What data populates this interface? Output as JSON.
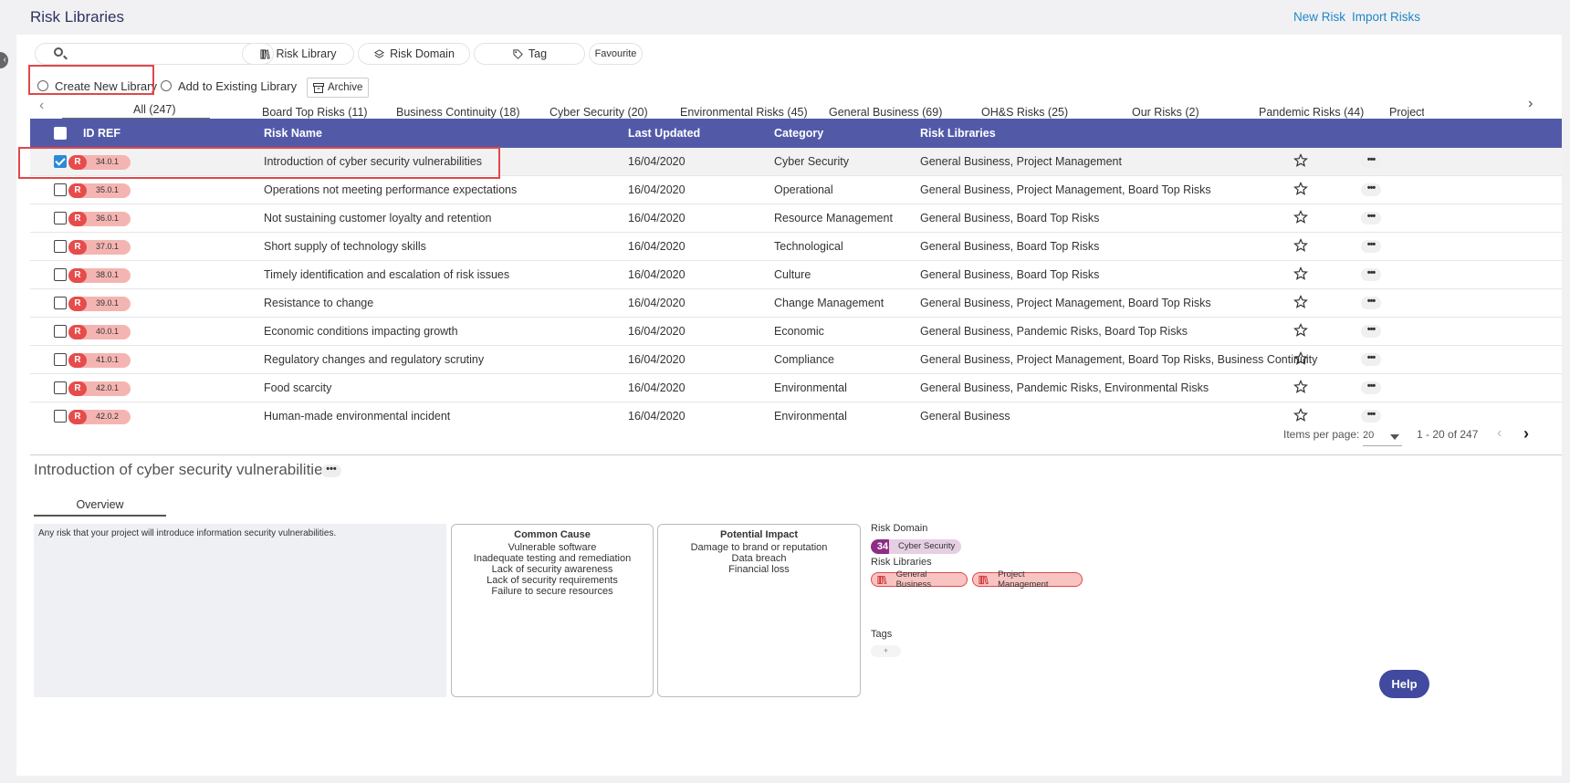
{
  "app": {
    "title": "Risk Libraries"
  },
  "header": {
    "new_risk": "New Risk",
    "import_risks": "Import Risks"
  },
  "search": {
    "value": "",
    "placeholder": ""
  },
  "filters": {
    "risk_library": "Risk Library",
    "risk_domain": "Risk Domain",
    "tag": "Tag",
    "favourite": "Favourite"
  },
  "actions": {
    "create_new_library": "Create New Library",
    "add_to_existing_library": "Add to Existing Library",
    "archive": "Archive"
  },
  "tabs": [
    {
      "label": "All (247)",
      "active": true
    },
    {
      "label": "Board Top Risks (11)"
    },
    {
      "label": "Business Continuity (18)"
    },
    {
      "label": "Cyber Security (20)"
    },
    {
      "label": "Environmental Risks (45)"
    },
    {
      "label": "General Business (69)"
    },
    {
      "label": "OH&S Risks (25)"
    },
    {
      "label": "Our Risks (2)"
    },
    {
      "label": "Pandemic Risks (44)"
    },
    {
      "label": "Project"
    }
  ],
  "table": {
    "headers": {
      "id_ref": "ID REF",
      "risk_name": "Risk Name",
      "last_updated": "Last Updated",
      "category": "Category",
      "risk_libraries": "Risk Libraries"
    },
    "rows": [
      {
        "badge": "R",
        "id": "34.0.1",
        "name": "Introduction of cyber security vulnerabilities",
        "updated": "16/04/2020",
        "category": "Cyber Security",
        "libraries": "General Business, Project Management",
        "checked": true
      },
      {
        "badge": "R",
        "id": "35.0.1",
        "name": "Operations not meeting performance expectations",
        "updated": "16/04/2020",
        "category": "Operational",
        "libraries": "General Business, Project Management, Board Top Risks",
        "checked": false
      },
      {
        "badge": "R",
        "id": "36.0.1",
        "name": "Not sustaining customer loyalty and retention",
        "updated": "16/04/2020",
        "category": "Resource Management",
        "libraries": "General Business, Board Top Risks",
        "checked": false
      },
      {
        "badge": "R",
        "id": "37.0.1",
        "name": "Short supply of technology skills",
        "updated": "16/04/2020",
        "category": "Technological",
        "libraries": "General Business, Board Top Risks",
        "checked": false
      },
      {
        "badge": "R",
        "id": "38.0.1",
        "name": "Timely identification and escalation of risk issues",
        "updated": "16/04/2020",
        "category": "Culture",
        "libraries": "General Business, Board Top Risks",
        "checked": false
      },
      {
        "badge": "R",
        "id": "39.0.1",
        "name": "Resistance to change",
        "updated": "16/04/2020",
        "category": "Change Management",
        "libraries": "General Business, Project Management, Board Top Risks",
        "checked": false
      },
      {
        "badge": "R",
        "id": "40.0.1",
        "name": "Economic conditions impacting growth",
        "updated": "16/04/2020",
        "category": "Economic",
        "libraries": "General Business, Pandemic Risks, Board Top Risks",
        "checked": false
      },
      {
        "badge": "R",
        "id": "41.0.1",
        "name": "Regulatory changes and regulatory scrutiny",
        "updated": "16/04/2020",
        "category": "Compliance",
        "libraries": "General Business, Project Management, Board Top Risks, Business Continuity",
        "checked": false
      },
      {
        "badge": "R",
        "id": "42.0.1",
        "name": "Food scarcity",
        "updated": "16/04/2020",
        "category": "Environmental",
        "libraries": "General Business, Pandemic Risks, Environmental Risks",
        "checked": false
      },
      {
        "badge": "R",
        "id": "42.0.2",
        "name": "Human-made environmental incident",
        "updated": "16/04/2020",
        "category": "Environmental",
        "libraries": "General Business",
        "checked": false
      }
    ]
  },
  "pagination": {
    "items_per_page_label": "Items per page:",
    "items_per_page": "20",
    "range": "1 - 20 of 247"
  },
  "detail": {
    "title": "Introduction of cyber security vulnerabilities",
    "tab": "Overview",
    "description": "Any risk that your project will introduce information security vulnerabilities.",
    "common_cause": {
      "title": "Common Cause",
      "items": [
        "Vulnerable software",
        "Inadequate testing and remediation",
        "Lack of security awareness",
        "Lack of security requirements",
        "Failure to secure resources"
      ]
    },
    "potential_impact": {
      "title": "Potential Impact",
      "items": [
        "Damage to brand or reputation",
        "Data breach",
        "Financial loss"
      ]
    },
    "risk_domain_label": "Risk Domain",
    "risk_domain": {
      "number": "34",
      "name": "Cyber Security"
    },
    "risk_libraries_label": "Risk Libraries",
    "risk_libraries": [
      "General Business",
      "Project Management"
    ],
    "tags_label": "Tags",
    "tag_add": "+"
  },
  "help": "Help",
  "icons": {
    "search": "search-icon",
    "star": "star-outline-icon",
    "more": "more-horizontal-icon",
    "library": "library-books-icon",
    "domain": "layers-icon",
    "tag": "tag-icon",
    "archive": "archive-icon"
  },
  "colors": {
    "header_bg": "#525aa8",
    "link": "#1f87c9",
    "badge_red": "#e64c4c",
    "domain_purple": "#8e2c86",
    "help_bg": "#414a9e",
    "highlight_red": "#e0474c"
  }
}
